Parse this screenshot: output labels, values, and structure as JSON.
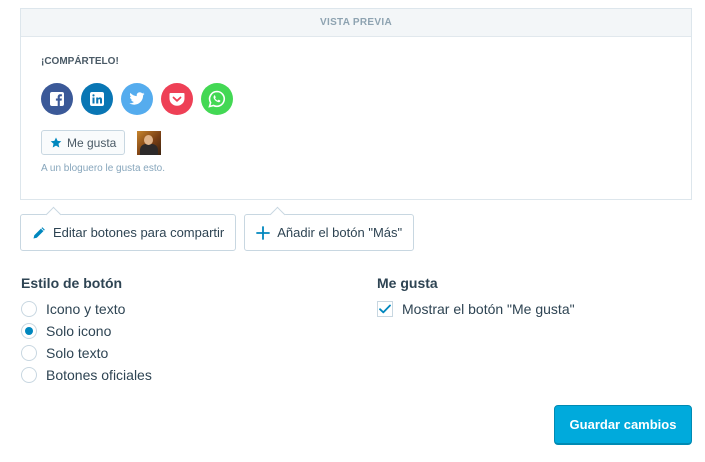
{
  "preview": {
    "header": "VISTA PREVIA",
    "share_heading": "¡COMPÁRTELO!",
    "share_icons": [
      {
        "name": "facebook-icon",
        "color": "#3b5998"
      },
      {
        "name": "linkedin-icon",
        "color": "#0976b4"
      },
      {
        "name": "twitter-icon",
        "color": "#55acee"
      },
      {
        "name": "pocket-icon",
        "color": "#ee4056"
      },
      {
        "name": "whatsapp-icon",
        "color": "#43d854"
      }
    ],
    "like_button_label": "Me gusta",
    "like_text": "A un bloguero le gusta esto."
  },
  "tabs": {
    "edit_label": "Editar botones para compartir",
    "more_label": "Añadir el botón \"Más\""
  },
  "button_style": {
    "title": "Estilo de botón",
    "options": [
      "Icono y texto",
      "Solo icono",
      "Solo texto",
      "Botones oficiales"
    ],
    "selected": "Solo icono"
  },
  "likes": {
    "title": "Me gusta",
    "checkbox_label": "Mostrar el botón \"Me gusta\"",
    "checked": true
  },
  "save_label": "Guardar cambios",
  "colors": {
    "accent": "#00aadc",
    "radio_selected": "#0087be"
  }
}
